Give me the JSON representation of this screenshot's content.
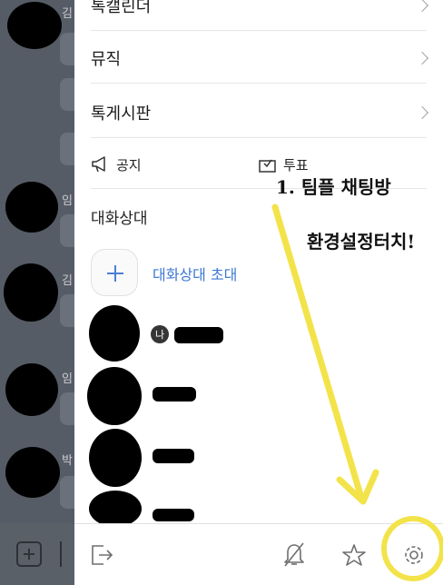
{
  "background_chat": {
    "names": [
      "김",
      "임",
      "김",
      "임",
      "박"
    ]
  },
  "drawer": {
    "menu_items": [
      {
        "label": "톡캘린더"
      },
      {
        "label": "뮤직"
      },
      {
        "label": "톡게시판"
      }
    ],
    "notice_label": "공지",
    "vote_label": "투표",
    "section_title": "대화상대",
    "invite_label": "대화상대 초대",
    "me_badge": "나"
  },
  "annotation": {
    "line1": "1. 팀플 채팅방",
    "line2": "환경설정터치!"
  },
  "toolbar": {
    "icons": [
      "exit-icon",
      "bell-off-icon",
      "star-icon",
      "gear-icon"
    ]
  },
  "colors": {
    "accent": "#3d78d3",
    "highlight": "#f3e34a",
    "dim_overlay": "#565c66"
  }
}
